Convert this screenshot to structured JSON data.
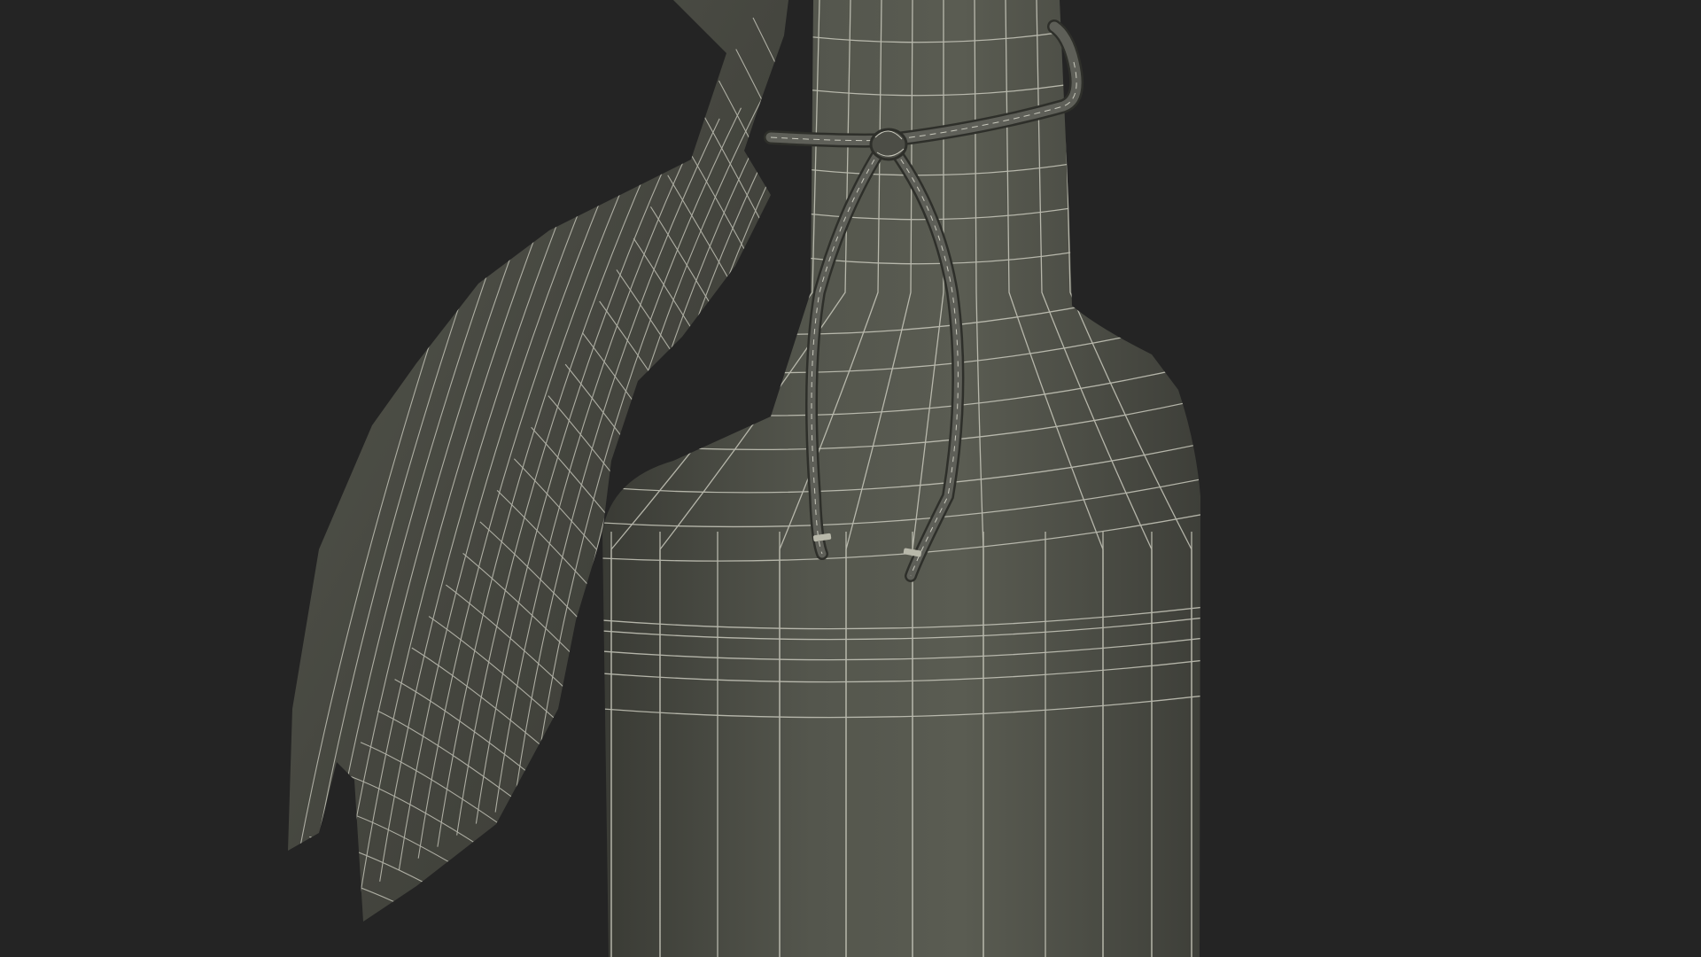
{
  "scene": {
    "subject": "bottle-wrapped-in-cloth-wireframe",
    "render_mode": "wireframe-on-shaded"
  },
  "colors": {
    "background": "#242424",
    "surface": "#4a4b43",
    "surface_light": "#5b5d54",
    "surface_shadow": "#33342f",
    "wire": "#c9c9bd",
    "rope": "#5e5f58"
  }
}
